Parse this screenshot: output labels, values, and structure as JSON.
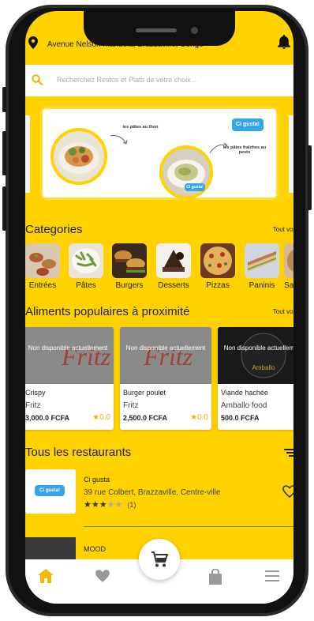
{
  "location": {
    "address": "Avenue Nelson Mandela, Brazzaville, Congo"
  },
  "search": {
    "placeholder": "Recherchez Restos et Plats de votre choix..."
  },
  "banner": {
    "dish1": "les pâtes au thon",
    "dish2": "les pâtes fraîches au pesto",
    "brand": "Ci gusta!"
  },
  "categories": {
    "title": "Categories",
    "see_all": "Tout voir",
    "items": [
      {
        "label": "Entrées"
      },
      {
        "label": "Pâtes"
      },
      {
        "label": "Burgers"
      },
      {
        "label": "Desserts"
      },
      {
        "label": "Pizzas"
      },
      {
        "label": "Paninis"
      },
      {
        "label": "Sa"
      }
    ]
  },
  "popular": {
    "title": "Aliments populaires à proximité",
    "see_all": "Tout voir",
    "unavailable": "Non disponible actuellement",
    "items": [
      {
        "name": "Crispy",
        "restaurant": "Fritz",
        "price": "3,000.0 FCFA",
        "rating": "0.0"
      },
      {
        "name": "Burger poulet",
        "restaurant": "Fritz",
        "price": "2,500.0 FCFA",
        "rating": "0.0"
      },
      {
        "name": "Viande hachée",
        "restaurant": "Amballo food",
        "price": "500.0 FCFA",
        "rating": ""
      }
    ]
  },
  "restaurants": {
    "title": "Tous les restaurants",
    "items": [
      {
        "name": "Ci gusta",
        "address": "39 rue Colbert, Brazzaville, Centre-ville",
        "rating": 3,
        "max_rating": 5,
        "reviews": "(1)",
        "logo_text": "Ci gusta!"
      },
      {
        "name": "MOOD"
      }
    ]
  },
  "nav": {
    "items": [
      "home-icon",
      "heart-icon",
      "cart-icon",
      "shopping-bag-icon",
      "menu-icon"
    ]
  },
  "colors": {
    "accent": "#FFD200",
    "brand_blue": "#37A6E8",
    "star": "#E8B500"
  }
}
